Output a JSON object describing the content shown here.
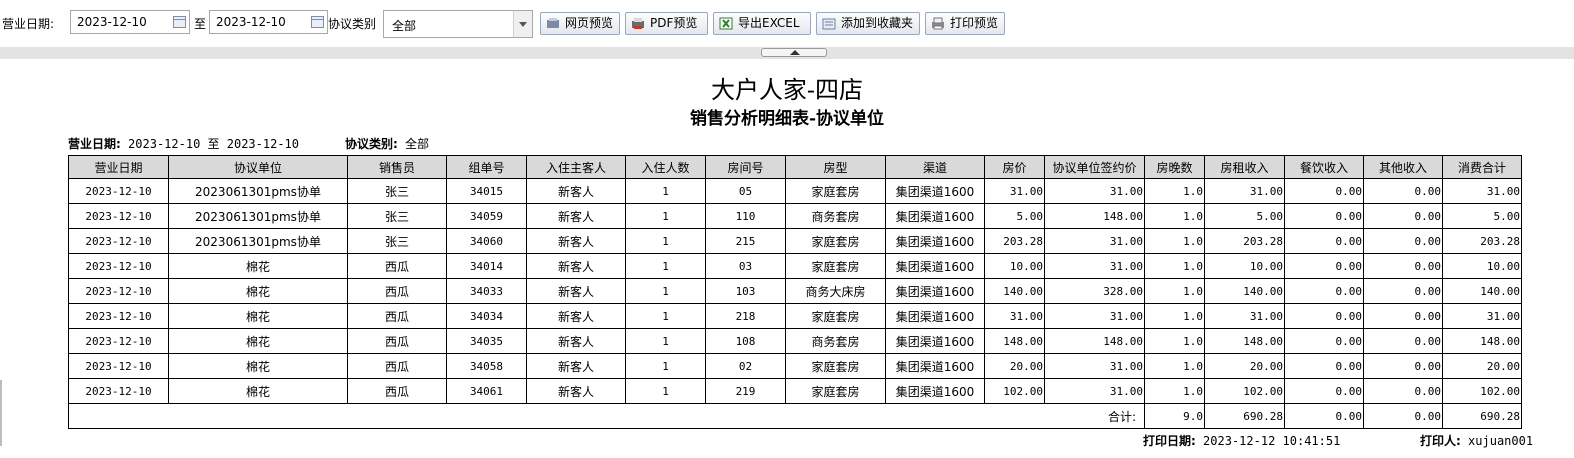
{
  "toolbar": {
    "business_date_label": "营业日期:",
    "date_from": "2023-12-10",
    "to_label": "至",
    "date_to": "2023-12-10",
    "category_label": "协议类别",
    "category_value": "全部",
    "buttons": [
      "网页预览",
      "PDF预览",
      "导出EXCEL",
      "添加到收藏夹",
      "打印预览"
    ]
  },
  "report": {
    "title": "大户人家-四店",
    "subtitle": "销售分析明细表-协议单位",
    "meta_date_label": "营业日期:",
    "meta_date_value": "2023-12-10 至 2023-12-10",
    "meta_category_label": "协议类别:",
    "meta_category_value": "全部",
    "columns": [
      "营业日期",
      "协议单位",
      "销售员",
      "组单号",
      "入住主客人",
      "入住人数",
      "房间号",
      "房型",
      "渠道",
      "房价",
      "协议单位签约价",
      "房晚数",
      "房租收入",
      "餐饮收入",
      "其他收入",
      "消费合计"
    ],
    "rows": [
      [
        "2023-12-10",
        "2023061301pms协单",
        "张三",
        "34015",
        "新客人",
        "1",
        "05",
        "家庭套房",
        "集团渠道1600",
        "31.00",
        "31.00",
        "1.0",
        "31.00",
        "0.00",
        "0.00",
        "31.00"
      ],
      [
        "2023-12-10",
        "2023061301pms协单",
        "张三",
        "34059",
        "新客人",
        "1",
        "110",
        "商务套房",
        "集团渠道1600",
        "5.00",
        "148.00",
        "1.0",
        "5.00",
        "0.00",
        "0.00",
        "5.00"
      ],
      [
        "2023-12-10",
        "2023061301pms协单",
        "张三",
        "34060",
        "新客人",
        "1",
        "215",
        "家庭套房",
        "集团渠道1600",
        "203.28",
        "31.00",
        "1.0",
        "203.28",
        "0.00",
        "0.00",
        "203.28"
      ],
      [
        "2023-12-10",
        "棉花",
        "西瓜",
        "34014",
        "新客人",
        "1",
        "03",
        "家庭套房",
        "集团渠道1600",
        "10.00",
        "31.00",
        "1.0",
        "10.00",
        "0.00",
        "0.00",
        "10.00"
      ],
      [
        "2023-12-10",
        "棉花",
        "西瓜",
        "34033",
        "新客人",
        "1",
        "103",
        "商务大床房",
        "集团渠道1600",
        "140.00",
        "328.00",
        "1.0",
        "140.00",
        "0.00",
        "0.00",
        "140.00"
      ],
      [
        "2023-12-10",
        "棉花",
        "西瓜",
        "34034",
        "新客人",
        "1",
        "218",
        "家庭套房",
        "集团渠道1600",
        "31.00",
        "31.00",
        "1.0",
        "31.00",
        "0.00",
        "0.00",
        "31.00"
      ],
      [
        "2023-12-10",
        "棉花",
        "西瓜",
        "34035",
        "新客人",
        "1",
        "108",
        "商务套房",
        "集团渠道1600",
        "148.00",
        "148.00",
        "1.0",
        "148.00",
        "0.00",
        "0.00",
        "148.00"
      ],
      [
        "2023-12-10",
        "棉花",
        "西瓜",
        "34058",
        "新客人",
        "1",
        "02",
        "家庭套房",
        "集团渠道1600",
        "20.00",
        "31.00",
        "1.0",
        "20.00",
        "0.00",
        "0.00",
        "20.00"
      ],
      [
        "2023-12-10",
        "棉花",
        "西瓜",
        "34061",
        "新客人",
        "1",
        "219",
        "家庭套房",
        "集团渠道1600",
        "102.00",
        "31.00",
        "1.0",
        "102.00",
        "0.00",
        "0.00",
        "102.00"
      ]
    ],
    "total": {
      "label": "合计:",
      "room_nights": "9.0",
      "room_revenue": "690.28",
      "food_revenue": "0.00",
      "other_revenue": "0.00",
      "total_consumption": "690.28"
    },
    "print_date_label": "打印日期:",
    "print_date_value": "2023-12-12 10:41:51",
    "printer_label": "打印人:",
    "printer_value": "xujuan001"
  }
}
